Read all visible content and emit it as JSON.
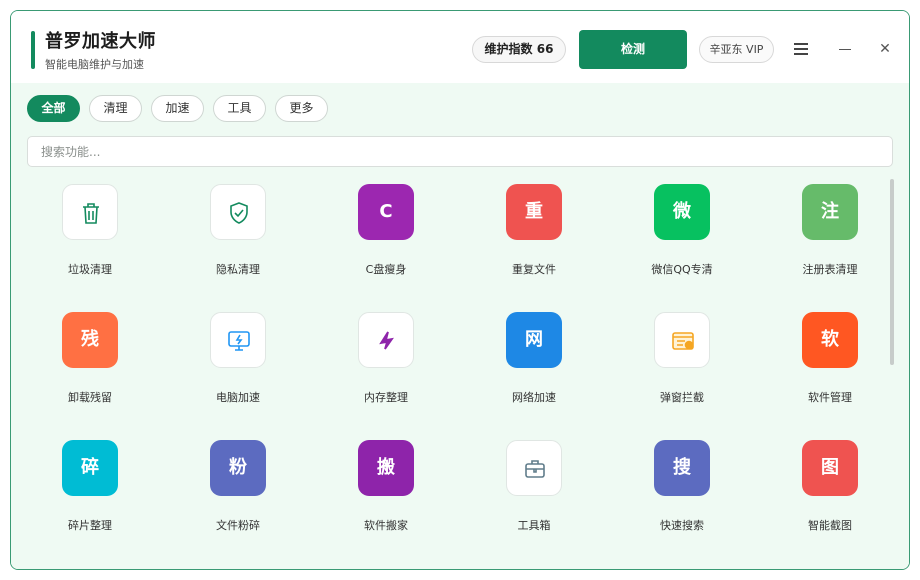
{
  "app": {
    "title": "普罗加速大师",
    "subtitle": "智能电脑维护与加速"
  },
  "header": {
    "score_label": "维护指数 66",
    "primary_button": "检测",
    "user_label": "辛亚东 VIP",
    "accent_color": "#138a5e"
  },
  "tabs": [
    {
      "label": "全部",
      "active": true
    },
    {
      "label": "清理",
      "active": false
    },
    {
      "label": "加速",
      "active": false
    },
    {
      "label": "工具",
      "active": false
    },
    {
      "label": "更多",
      "active": false
    }
  ],
  "search": {
    "placeholder": "搜索功能...",
    "value": ""
  },
  "tools": [
    {
      "label": "垃圾清理",
      "icon": "trash-icon",
      "glyph": "",
      "color": "#ffffff"
    },
    {
      "label": "隐私清理",
      "icon": "shield-check-icon",
      "glyph": "",
      "color": "#ffffff"
    },
    {
      "label": "C盘瘦身",
      "icon": "c-letter-icon",
      "glyph": "C",
      "color": "#9c27b0"
    },
    {
      "label": "重复文件",
      "icon": "duplicate-icon",
      "glyph": "重",
      "color": "#ef5350"
    },
    {
      "label": "微信QQ专清",
      "icon": "wechat-icon",
      "glyph": "微",
      "color": "#07c160"
    },
    {
      "label": "注册表清理",
      "icon": "registry-icon",
      "glyph": "注",
      "color": "#66bb6a"
    },
    {
      "label": "卸载残留",
      "icon": "uninstall-icon",
      "glyph": "残",
      "color": "#ff7043"
    },
    {
      "label": "电脑加速",
      "icon": "monitor-bolt-icon",
      "glyph": "",
      "color": "#ffffff"
    },
    {
      "label": "内存整理",
      "icon": "memory-icon",
      "glyph": "",
      "color": "#ffffff"
    },
    {
      "label": "网络加速",
      "icon": "network-icon",
      "glyph": "网",
      "color": "#1e88e5"
    },
    {
      "label": "弹窗拦截",
      "icon": "popup-block-icon",
      "glyph": "",
      "color": "#ffffff"
    },
    {
      "label": "软件管理",
      "icon": "software-icon",
      "glyph": "软",
      "color": "#ff5722"
    },
    {
      "label": "碎片整理",
      "icon": "defrag-icon",
      "glyph": "碎",
      "color": "#00bcd4"
    },
    {
      "label": "文件粉碎",
      "icon": "shredder-icon",
      "glyph": "粉",
      "color": "#5c6bc0"
    },
    {
      "label": "软件搬家",
      "icon": "move-icon",
      "glyph": "搬",
      "color": "#8e24aa"
    },
    {
      "label": "工具箱",
      "icon": "toolbox-icon",
      "glyph": "",
      "color": "#ffffff"
    },
    {
      "label": "快速搜索",
      "icon": "search-fast-icon",
      "glyph": "搜",
      "color": "#5c6bc0"
    },
    {
      "label": "智能截图",
      "icon": "screenshot-icon",
      "glyph": "图",
      "color": "#ef5350"
    }
  ]
}
